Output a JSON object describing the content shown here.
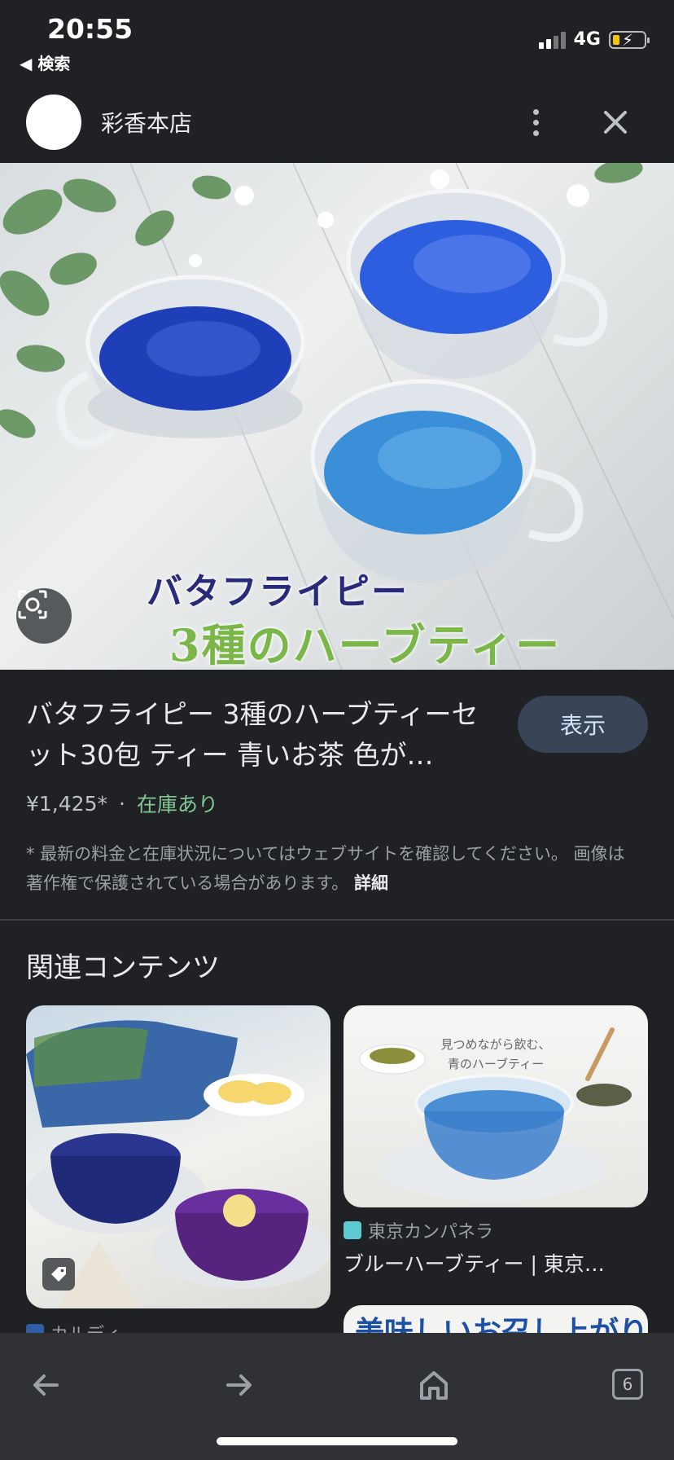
{
  "status_bar": {
    "time": "20:55",
    "back_label": "◀ 検索",
    "network": "4G"
  },
  "header": {
    "site_name": "彩香本店",
    "more_icon": "more-vert-icon",
    "close_icon": "close-icon"
  },
  "hero_image": {
    "text_line1": "バタフライピー",
    "text_line2": "3種のハーブティー"
  },
  "product": {
    "title": "バタフライピー 3種のハーブティーセット30包 ティー 青いお茶 色が…",
    "view_button": "表示",
    "price": "¥1,425*",
    "separator": "·",
    "stock": "在庫あり",
    "notice": "* 最新の料金と在庫状況についてはウェブサイトを確認してください。 画像は著作権で保護されている場合があります。",
    "details_link": "詳細"
  },
  "related": {
    "heading": "関連コンテンツ",
    "items": [
      {
        "source": "カルディ",
        "title": ""
      },
      {
        "source": "東京カンパネラ",
        "title": "ブルーハーブティー | 東京…",
        "caption_line1": "見つめながら飲む、",
        "caption_line2": "青のハーブティー"
      },
      {
        "image_text": "美味しいお召し上がり方"
      }
    ]
  },
  "bottom_bar": {
    "tab_count": "6"
  },
  "colors": {
    "background": "#202124",
    "accent_button": "#394457",
    "stock_green": "#81c995"
  }
}
